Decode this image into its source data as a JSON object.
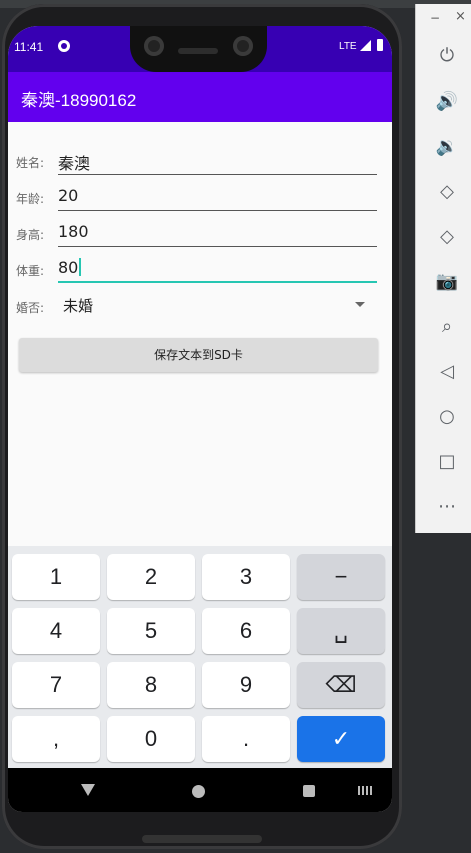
{
  "status_bar": {
    "time": "11:41",
    "network": "LTE"
  },
  "app_bar": {
    "title": "秦澳-18990162"
  },
  "form": {
    "fields": [
      {
        "label": "姓名:",
        "value": "秦澳"
      },
      {
        "label": "年龄:",
        "value": "20"
      },
      {
        "label": "身高:",
        "value": "180"
      },
      {
        "label": "体重:",
        "value": "80"
      }
    ],
    "married": {
      "label": "婚否:",
      "value": "未婚"
    },
    "save_button": "保存文本到SD卡"
  },
  "keyboard": {
    "rows": [
      [
        "1",
        "2",
        "3",
        "−"
      ],
      [
        "4",
        "5",
        "6",
        "␣"
      ],
      [
        "7",
        "8",
        "9",
        "⌫"
      ],
      [
        ",",
        "0",
        ".",
        "✓"
      ]
    ]
  },
  "side_panel": {
    "minimize": "−",
    "close": "×",
    "tools": [
      "power-icon",
      "volume-up-icon",
      "volume-down-icon",
      "rotate-left-icon",
      "rotate-right-icon",
      "camera-icon",
      "zoom-icon",
      "back-icon",
      "home-icon",
      "overview-icon",
      "more-icon"
    ]
  },
  "colors": {
    "status_bar": "#3700b3",
    "app_bar": "#6200ee",
    "focus": "#26c6b2",
    "done_key": "#1a73e8"
  }
}
